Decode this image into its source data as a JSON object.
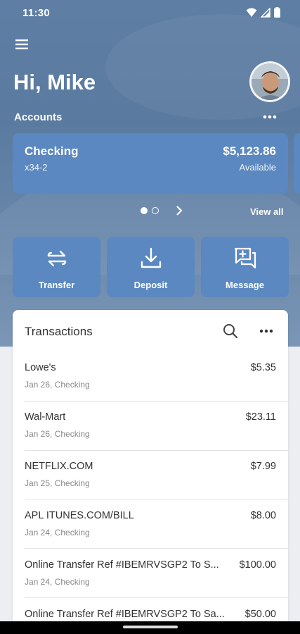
{
  "status_bar": {
    "time": "11:30",
    "icons": [
      "wifi-icon",
      "signal-icon",
      "battery-icon"
    ]
  },
  "header": {
    "menu_icon": "hamburger-menu-icon",
    "greeting": "Hi, Mike",
    "avatar": "user-avatar"
  },
  "accounts": {
    "section_label": "Accounts",
    "more_icon": "more-horizontal-icon",
    "cards": [
      {
        "name": "Checking",
        "number": "x34-2",
        "balance": "$5,123.86",
        "balance_label": "Available"
      }
    ],
    "pager": {
      "active_index": 0,
      "count": 2
    },
    "view_all_label": "View all"
  },
  "actions": [
    {
      "label": "Transfer",
      "icon": "transfer-arrows-icon"
    },
    {
      "label": "Deposit",
      "icon": "deposit-download-icon"
    },
    {
      "label": "Message",
      "icon": "message-add-icon"
    }
  ],
  "transactions": {
    "title": "Transactions",
    "search_icon": "search-icon",
    "more_icon": "more-horizontal-icon",
    "items": [
      {
        "merchant": "Lowe's",
        "meta": "Jan 26, Checking",
        "amount": "$5.35"
      },
      {
        "merchant": "Wal-Mart",
        "meta": "Jan 26, Checking",
        "amount": "$23.11"
      },
      {
        "merchant": "NETFLIX.COM",
        "meta": "Jan 25, Checking",
        "amount": "$7.99"
      },
      {
        "merchant": "APL ITUNES.COM/BILL",
        "meta": "Jan 24, Checking",
        "amount": "$8.00"
      },
      {
        "merchant": "Online Transfer Ref #IBEMRVSGP2 To S...",
        "meta": "Jan 24, Checking",
        "amount": "$100.00"
      },
      {
        "merchant": "Online Transfer Ref #IBEMRVSGP2 To Sa...",
        "meta": "",
        "amount": "$50.00"
      }
    ]
  },
  "colors": {
    "hero_background": "#5e7ea3",
    "tile_background": "#5b88c0",
    "page_background": "#eceef1",
    "card_background": "#ffffff"
  }
}
